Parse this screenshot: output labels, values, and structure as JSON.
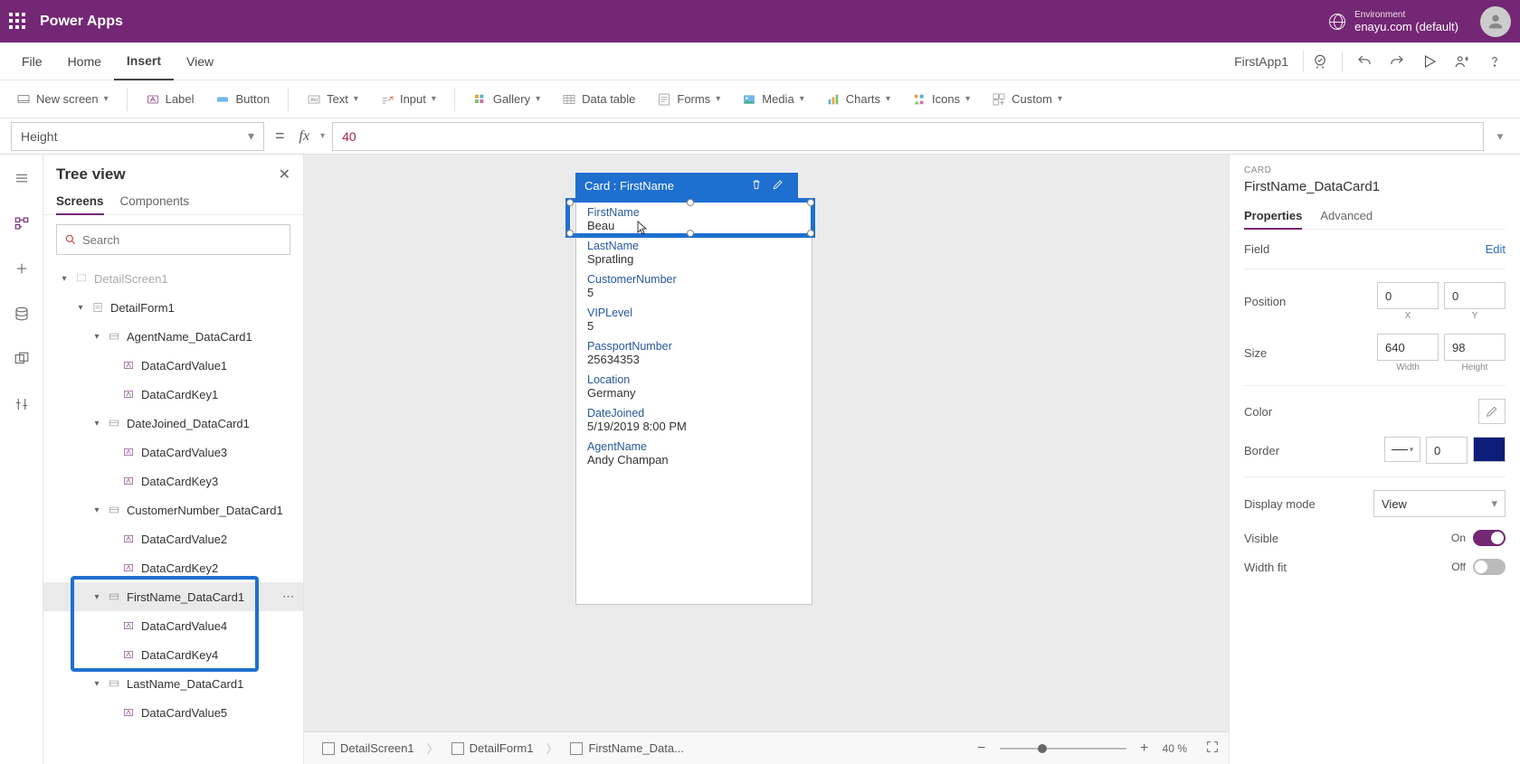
{
  "topbar": {
    "brand": "Power Apps",
    "env_label": "Environment",
    "env_value": "enayu.com (default)"
  },
  "menu": {
    "items": [
      "File",
      "Home",
      "Insert",
      "View"
    ],
    "active": 2,
    "app_name": "FirstApp1"
  },
  "ribbon": {
    "new_screen": "New screen",
    "label": "Label",
    "button": "Button",
    "text": "Text",
    "input": "Input",
    "gallery": "Gallery",
    "datatable": "Data table",
    "forms": "Forms",
    "media": "Media",
    "charts": "Charts",
    "icons": "Icons",
    "custom": "Custom"
  },
  "formula": {
    "property": "Height",
    "value": "40"
  },
  "tree": {
    "title": "Tree view",
    "tabs": [
      "Screens",
      "Components"
    ],
    "active_tab": 0,
    "search_placeholder": "Search",
    "nodes": {
      "detail_screen": "DetailScreen1",
      "detail_form": "DetailForm1",
      "agent_card": "AgentName_DataCard1",
      "dcv1": "DataCardValue1",
      "dck1": "DataCardKey1",
      "datejoined_card": "DateJoined_DataCard1",
      "dcv3": "DataCardValue3",
      "dck3": "DataCardKey3",
      "custnum_card": "CustomerNumber_DataCard1",
      "dcv2": "DataCardValue2",
      "dck2": "DataCardKey2",
      "firstname_card": "FirstName_DataCard1",
      "dcv4": "DataCardValue4",
      "dck4": "DataCardKey4",
      "lastname_card": "LastName_DataCard1",
      "dcv5": "DataCardValue5"
    }
  },
  "canvas": {
    "card_label": "Card : FirstName",
    "fields": [
      {
        "label": "FirstName",
        "value": "Beau"
      },
      {
        "label": "LastName",
        "value": "Spratling"
      },
      {
        "label": "CustomerNumber",
        "value": "5"
      },
      {
        "label": "VIPLevel",
        "value": "5"
      },
      {
        "label": "PassportNumber",
        "value": "25634353"
      },
      {
        "label": "Location",
        "value": "Germany"
      },
      {
        "label": "DateJoined",
        "value": "5/19/2019 8:00 PM"
      },
      {
        "label": "AgentName",
        "value": "Andy Champan"
      }
    ]
  },
  "props": {
    "section": "CARD",
    "name": "FirstName_DataCard1",
    "tabs": [
      "Properties",
      "Advanced"
    ],
    "active_tab": 0,
    "field_lbl": "Field",
    "edit": "Edit",
    "position_lbl": "Position",
    "pos_x": "0",
    "pos_y": "0",
    "x_lbl": "X",
    "y_lbl": "Y",
    "size_lbl": "Size",
    "size_w": "640",
    "size_h": "98",
    "w_lbl": "Width",
    "h_lbl": "Height",
    "color_lbl": "Color",
    "border_lbl": "Border",
    "border_val": "0",
    "display_lbl": "Display mode",
    "display_val": "View",
    "visible_lbl": "Visible",
    "visible_val": "On",
    "widthfit_lbl": "Width fit",
    "widthfit_val": "Off"
  },
  "status": {
    "crumbs": [
      "DetailScreen1",
      "DetailForm1",
      "FirstName_Data..."
    ],
    "zoom": "40  %"
  }
}
